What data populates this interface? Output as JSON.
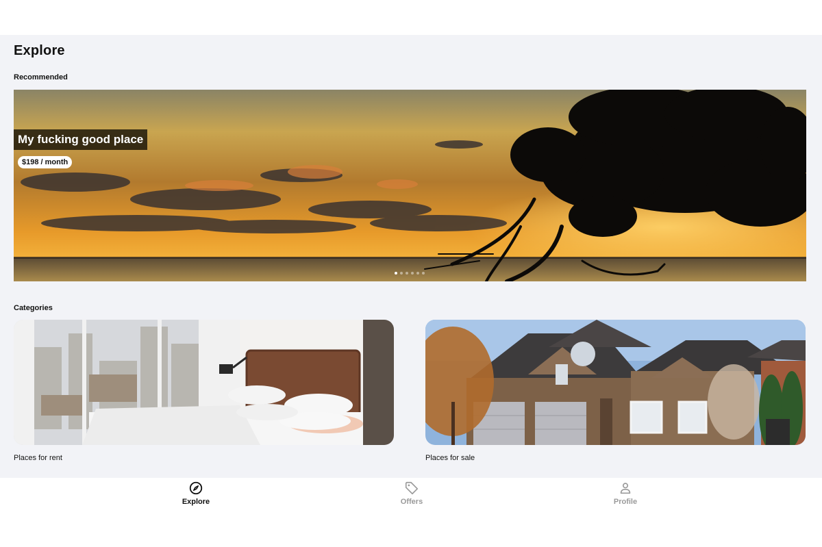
{
  "page": {
    "title": "Explore"
  },
  "recommended": {
    "section_title": "Recommended",
    "banner": {
      "title": "My fucking good place",
      "price": "$198 / month",
      "slide_count": 6,
      "active_slide": 0
    }
  },
  "categories": {
    "section_title": "Categories",
    "items": [
      {
        "label": "Places for rent",
        "image": "bedroom-photo"
      },
      {
        "label": "Places for sale",
        "image": "house-photo"
      }
    ]
  },
  "tabbar": {
    "tabs": [
      {
        "label": "Explore",
        "icon": "compass-icon",
        "active": true
      },
      {
        "label": "Offers",
        "icon": "tag-icon",
        "active": false
      },
      {
        "label": "Profile",
        "icon": "person-icon",
        "active": false
      }
    ]
  },
  "colors": {
    "background": "#f2f3f7",
    "active_tab": "#111111",
    "inactive_tab": "#9a9a9a"
  }
}
